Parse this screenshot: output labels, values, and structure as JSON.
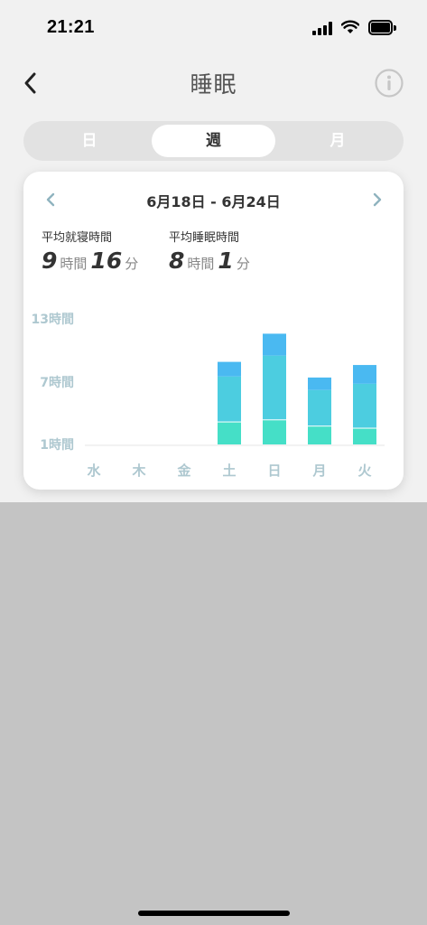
{
  "status_bar": {
    "time": "21:21"
  },
  "nav": {
    "title": "睡眠"
  },
  "tabs": [
    {
      "label": "日",
      "active": false
    },
    {
      "label": "週",
      "active": true
    },
    {
      "label": "月",
      "active": false
    }
  ],
  "card": {
    "date_range": "6月18日 - 6月24日",
    "avg_bedtime": {
      "label": "平均就寝時間",
      "hours": "9",
      "hours_unit": "時間",
      "minutes": "16",
      "minutes_unit": "分"
    },
    "avg_sleep": {
      "label": "平均睡眠時間",
      "hours": "8",
      "hours_unit": "時間",
      "minutes": "1",
      "minutes_unit": "分"
    }
  },
  "colors": {
    "light_sleep": "#4ab9f1",
    "mid_sleep": "#4ccde0",
    "deep_sleep": "#45dfc7",
    "axis_label": "#aec8d0"
  },
  "chart_data": {
    "type": "bar",
    "stacked": true,
    "categories": [
      "水",
      "木",
      "金",
      "土",
      "日",
      "月",
      "火"
    ],
    "y_tick_labels": [
      "13時間",
      "7時間",
      "1時間"
    ],
    "y_ticks": [
      13,
      7,
      1
    ],
    "ylim": [
      0,
      13
    ],
    "series": [
      {
        "values": [
          0,
          0,
          0,
          2.2,
          2.4,
          1.8,
          1.6
        ]
      },
      {
        "values": [
          0,
          0,
          0,
          4.4,
          6.2,
          3.5,
          4.3
        ]
      },
      {
        "values": [
          0,
          0,
          0,
          1.4,
          2.1,
          1.2,
          1.8
        ]
      }
    ]
  }
}
